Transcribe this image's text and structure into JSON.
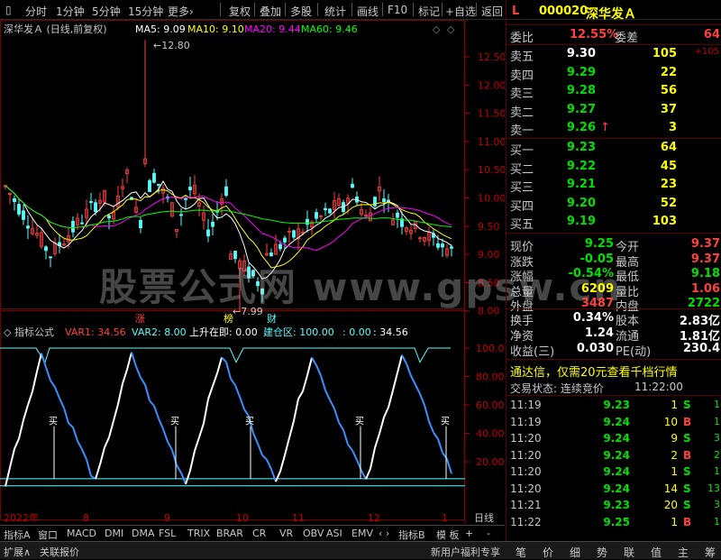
{
  "toolbar": {
    "items": [
      "分时",
      "1分钟",
      "5分钟",
      "15分钟",
      "更多›",
      "复权",
      "叠加",
      "多股",
      "统计",
      "画线",
      "F10",
      "标记",
      "+自选",
      "返回"
    ]
  },
  "chart": {
    "title": "深华发Ａ (日线,前复权)",
    "ma5": "MA5: 9.09",
    "ma10": "MA10: 9.10",
    "ma20": "MA20: 9.44",
    "ma60": "MA60: 9.46",
    "high_mark": "12.80",
    "low_mark": "7.99",
    "price_axis": [
      "12.50",
      "12.00",
      "11.50",
      "11.00",
      "10.50",
      "10.00",
      "9.50",
      "9.00",
      "8.50",
      "8.00"
    ],
    "events": [
      "涨",
      "榜",
      "财"
    ],
    "indicator_title": "指标公式",
    "var1": "VAR1: 34.56",
    "var2": "VAR2: 8.00",
    "rise": "上升在即: 0.00",
    "build": "建仓区: 100.00",
    "v5": ": 0.00",
    "v6": ": 34.56",
    "ind_axis": [
      "100.0",
      "80.00",
      "60.00",
      "40.00",
      "20.00"
    ],
    "buy_label": "买",
    "time_axis": [
      "2022年",
      "8",
      "9",
      "10",
      "11",
      "12",
      "1"
    ],
    "period_label": "日线"
  },
  "colors": {
    "up": "#ff4040",
    "down": "#54ffff",
    "ma5": "#ffffff",
    "ma10": "#ffff00",
    "ma20": "#ff00ff",
    "ma60": "#00ff00"
  },
  "bottom_tabs": [
    "指标A",
    "窗口",
    "MACD",
    "DMI",
    "DMA",
    "FSL",
    "TRIX",
    "BRAR",
    "CR",
    "VR",
    "OBV",
    "ASI",
    "EMV",
    "‹ ›",
    "指标B",
    "模 板",
    "+",
    "-"
  ],
  "footer": {
    "left": [
      "扩展∧",
      "关联报价"
    ],
    "promo": "新用户福利专享",
    "tabs": [
      "笔",
      "价",
      "细",
      "势",
      "联",
      "值",
      "主",
      "筹"
    ]
  },
  "quote": {
    "marker": "L",
    "code": "000020",
    "name": "深华发Ａ",
    "weibi_label": "委比",
    "weibi": "12.55%",
    "weicha_label": "委差",
    "weicha": "64",
    "asks": [
      {
        "label": "卖五",
        "price": "9.30",
        "vol": "105",
        "extra": "+105"
      },
      {
        "label": "卖四",
        "price": "9.29",
        "vol": "22",
        "extra": ""
      },
      {
        "label": "卖三",
        "price": "9.28",
        "vol": "56",
        "extra": ""
      },
      {
        "label": "卖二",
        "price": "9.27",
        "vol": "37",
        "extra": ""
      },
      {
        "label": "卖一",
        "price": "9.26",
        "vol": "3",
        "extra": ""
      }
    ],
    "ask_arrow": "↑",
    "bids": [
      {
        "label": "买一",
        "price": "9.23",
        "vol": "64"
      },
      {
        "label": "买二",
        "price": "9.22",
        "vol": "45"
      },
      {
        "label": "买三",
        "price": "9.21",
        "vol": "23"
      },
      {
        "label": "买四",
        "price": "9.20",
        "vol": "52"
      },
      {
        "label": "买五",
        "price": "9.19",
        "vol": "103"
      }
    ],
    "stats": [
      {
        "l1": "现价",
        "v1": "9.25",
        "c1": "green",
        "l2": "今开",
        "v2": "9.37",
        "c2": "red"
      },
      {
        "l1": "涨跌",
        "v1": "-0.05",
        "c1": "green",
        "l2": "最高",
        "v2": "9.37",
        "c2": "red"
      },
      {
        "l1": "涨幅",
        "v1": "-0.54%",
        "c1": "green",
        "l2": "最低",
        "v2": "9.18",
        "c2": "green"
      },
      {
        "l1": "总量",
        "v1": "6209",
        "c1": "yellow",
        "l2": "量比",
        "v2": "1.06",
        "c2": "red"
      },
      {
        "l1": "外盘",
        "v1": "3487",
        "c1": "red",
        "l2": "内盘",
        "v2": "2722",
        "c2": "green"
      }
    ],
    "fund": [
      {
        "l1": "换手",
        "v1": "0.34%",
        "l2": "股本",
        "v2": "2.83亿"
      },
      {
        "l1": "净资",
        "v1": "1.24",
        "l2": "流通",
        "v2": "1.81亿"
      },
      {
        "l1": "收益(三)",
        "v1": "0.030",
        "l2": "PE(动)",
        "v2": "230.4"
      }
    ],
    "ad": "通达信，仅需20元查看千档行情",
    "trade_status": "交易状态: 连续竞价",
    "trade_time": "11:22:00",
    "ticks": [
      {
        "t": "11:19",
        "p": "9.23",
        "v": "1",
        "s": "S",
        "n": "1"
      },
      {
        "t": "11:19",
        "p": "9.24",
        "v": "10",
        "s": "B",
        "n": "1"
      },
      {
        "t": "11:20",
        "p": "9.24",
        "v": "9",
        "s": "S",
        "n": "3"
      },
      {
        "t": "11:20",
        "p": "9.24",
        "v": "2",
        "s": "B",
        "n": "2"
      },
      {
        "t": "11:20",
        "p": "9.24",
        "v": "1",
        "s": "S",
        "n": "1"
      },
      {
        "t": "11:20",
        "p": "9.24",
        "v": "14",
        "s": "S",
        "n": "13"
      },
      {
        "t": "11:21",
        "p": "9.23",
        "v": "20",
        "s": "S",
        "n": "3"
      },
      {
        "t": "11:22",
        "p": "9.25",
        "v": "1",
        "s": "B",
        "n": "1"
      }
    ]
  },
  "watermark": "股票公式网 www.gpsw.cn"
}
